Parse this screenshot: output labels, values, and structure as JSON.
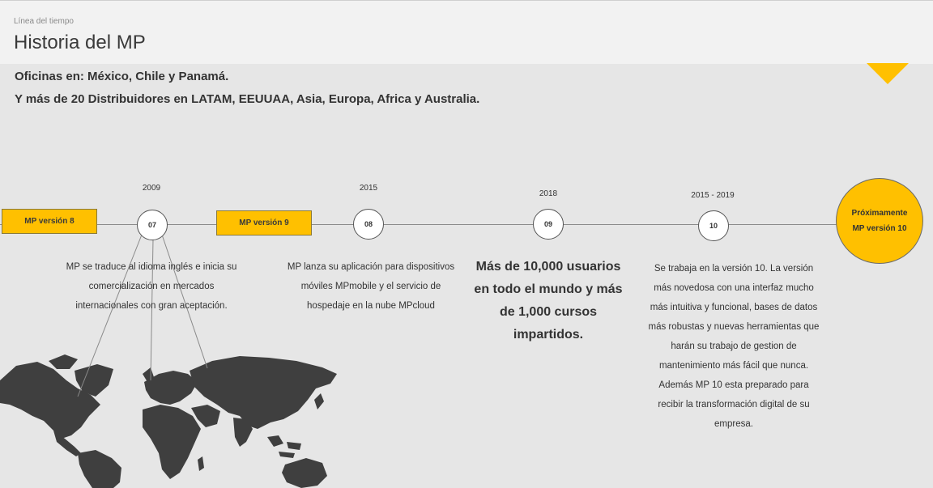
{
  "header": {
    "breadcrumb": "Línea del tiempo",
    "title": "Historia del MP"
  },
  "offices": {
    "line1": "Oficinas en: México, Chile y Panamá.",
    "line2": "Y más de 20 Distribuidores en LATAM,  EEUUAA, Asia, Europa, Africa y Australia."
  },
  "timeline": {
    "version8": "MP versión 8",
    "version9": "MP versión 9",
    "nodes": [
      {
        "year": "2009",
        "number": "07"
      },
      {
        "year": "2015",
        "number": "08"
      },
      {
        "year": "2018",
        "number": "09"
      },
      {
        "year": "2015 - 2019",
        "number": "10"
      }
    ],
    "future": {
      "line1": "Próximamente",
      "line2": "MP versión 10"
    }
  },
  "descriptions": {
    "d07": [
      "MP se traduce al idioma inglés e inicia su",
      "comercialización en mercados",
      "internacionales con gran aceptación."
    ],
    "d08": [
      "MP lanza su aplicación para dispositivos",
      "móviles MPmobile y el servicio de",
      "hospedaje en la nube MPcloud"
    ],
    "d09": [
      "Más de 10,000 usuarios",
      "en todo el mundo y más",
      "de 1,000 cursos",
      "impartidos."
    ],
    "d10": [
      "Se trabaja en la versión 10. La versión",
      "más novedosa con una interfaz mucho",
      "más intuitiva y funcional, bases de datos",
      "más robustas y nuevas herramientas que",
      "harán su trabajo de gestion de",
      "mantenimiento más fácil que nunca.",
      "Además MP 10 esta preparado para",
      "recibir la transformación digital de su",
      "empresa."
    ]
  },
  "colors": {
    "accent": "#ffc000",
    "background": "#e6e6e6",
    "header_bg": "#f2f2f2",
    "map": "#3f3f3f"
  },
  "icons": {
    "map": "world-map-icon"
  }
}
